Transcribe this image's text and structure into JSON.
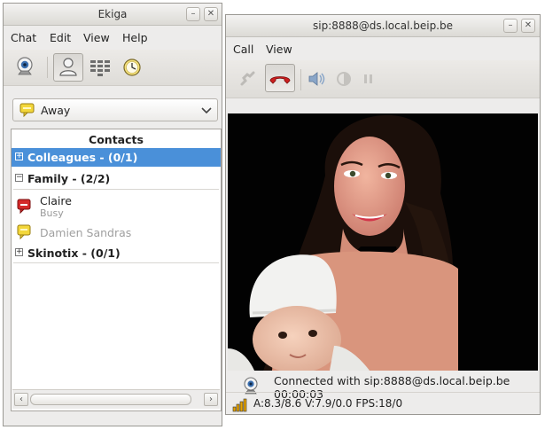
{
  "ekiga": {
    "title": "Ekiga",
    "menu": [
      "Chat",
      "Edit",
      "View",
      "Help"
    ],
    "toolbar": [
      "webcam-icon",
      "contacts-icon",
      "dialpad-icon",
      "call-history-icon"
    ],
    "status": "Away",
    "contacts_header": "Contacts",
    "groups": [
      {
        "label": "Colleagues - (0/1)",
        "expanded": false,
        "selected": true
      },
      {
        "label": "Family - (2/2)",
        "expanded": true,
        "selected": false
      },
      {
        "label": "Skinotix - (0/1)",
        "expanded": false,
        "selected": false
      }
    ],
    "family_contacts": [
      {
        "name": "Claire",
        "status": "Busy",
        "icon": "busy-icon"
      },
      {
        "name": "Damien Sandras",
        "status": "",
        "icon": "away-icon"
      }
    ]
  },
  "call": {
    "title": "sip:8888@ds.local.beip.be",
    "menu": [
      "Call",
      "View"
    ],
    "toolbar": [
      "pickup-icon",
      "hangup-icon",
      "volume-icon",
      "video-settings-icon",
      "pause-icon"
    ],
    "connected_text": "Connected with sip:8888@ds.local.beip.be",
    "duration": "00:00:03",
    "stats": "A:8.3/8.6 V:7.9/0.0 FPS:18/0"
  },
  "colors": {
    "selection": "#4a90d9",
    "busy": "#d42a2a",
    "away": "#f0d43a",
    "hangup": "#cc1f1f"
  }
}
